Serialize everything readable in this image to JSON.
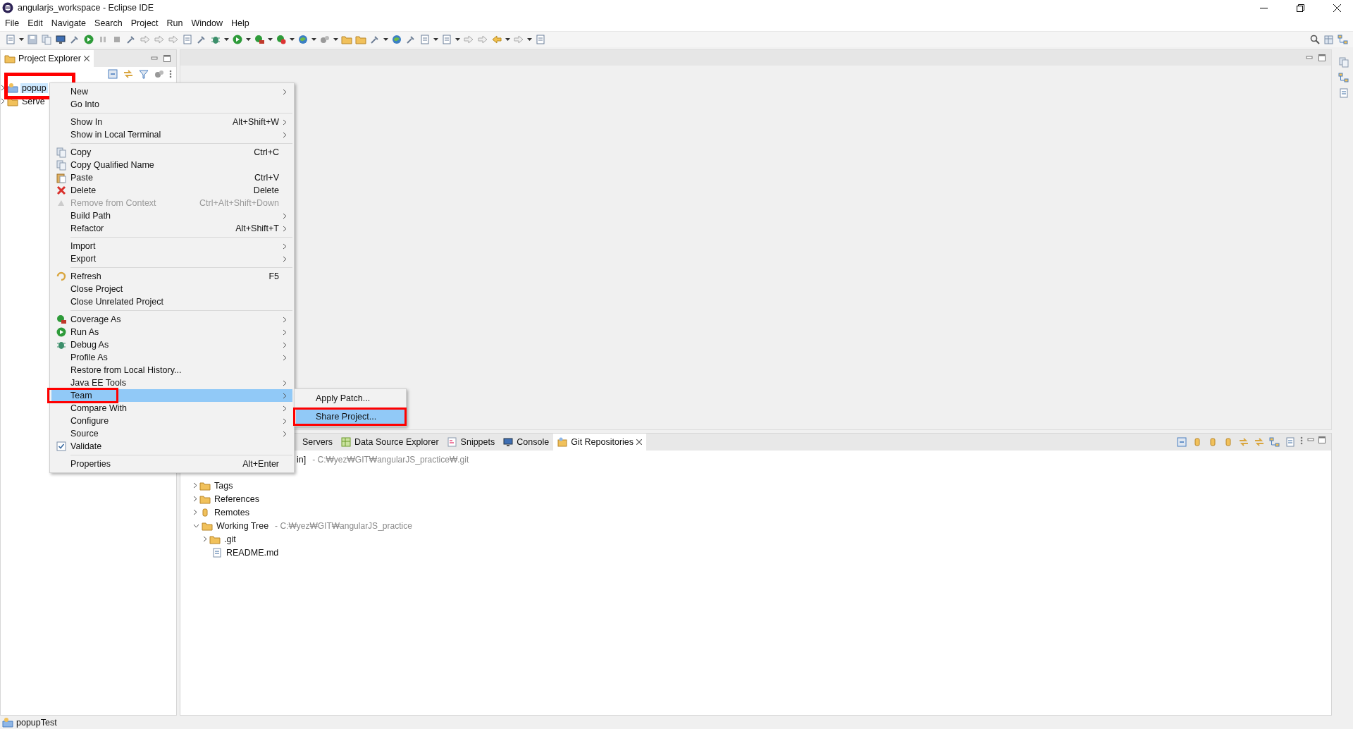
{
  "window": {
    "title": "angularjs_workspace - Eclipse IDE"
  },
  "menu_bar": [
    "File",
    "Edit",
    "Navigate",
    "Search",
    "Project",
    "Run",
    "Window",
    "Help"
  ],
  "project_explorer": {
    "title": "Project Explorer",
    "items": [
      {
        "label": "popup",
        "selected": true
      },
      {
        "label": "Serve",
        "selected": false
      }
    ]
  },
  "context_menu": {
    "items": [
      {
        "kind": "item",
        "label": "New",
        "submenu": true,
        "disabled": false,
        "selected": false
      },
      {
        "kind": "item",
        "label": "Go Into",
        "submenu": false,
        "disabled": false,
        "selected": false
      },
      {
        "kind": "separator"
      },
      {
        "kind": "item",
        "label": "Show In",
        "shortcut": "Alt+Shift+W",
        "submenu": true,
        "disabled": false,
        "selected": false
      },
      {
        "kind": "item",
        "label": "Show in Local Terminal",
        "submenu": true,
        "disabled": false,
        "selected": false
      },
      {
        "kind": "separator"
      },
      {
        "kind": "item",
        "label": "Copy",
        "shortcut": "Ctrl+C",
        "submenu": false,
        "disabled": false,
        "selected": false
      },
      {
        "kind": "item",
        "label": "Copy Qualified Name",
        "submenu": false,
        "disabled": false,
        "selected": false
      },
      {
        "kind": "item",
        "label": "Paste",
        "shortcut": "Ctrl+V",
        "submenu": false,
        "disabled": false,
        "selected": false
      },
      {
        "kind": "item",
        "label": "Delete",
        "shortcut": "Delete",
        "submenu": false,
        "disabled": false,
        "selected": false
      },
      {
        "kind": "item",
        "label": "Remove from Context",
        "shortcut": "Ctrl+Alt+Shift+Down",
        "submenu": false,
        "disabled": true,
        "selected": false
      },
      {
        "kind": "item",
        "label": "Build Path",
        "submenu": true,
        "disabled": false,
        "selected": false
      },
      {
        "kind": "item",
        "label": "Refactor",
        "shortcut": "Alt+Shift+T",
        "submenu": true,
        "disabled": false,
        "selected": false
      },
      {
        "kind": "separator"
      },
      {
        "kind": "item",
        "label": "Import",
        "submenu": true,
        "disabled": false,
        "selected": false
      },
      {
        "kind": "item",
        "label": "Export",
        "submenu": true,
        "disabled": false,
        "selected": false
      },
      {
        "kind": "separator"
      },
      {
        "kind": "item",
        "label": "Refresh",
        "shortcut": "F5",
        "submenu": false,
        "disabled": false,
        "selected": false
      },
      {
        "kind": "item",
        "label": "Close Project",
        "submenu": false,
        "disabled": false,
        "selected": false
      },
      {
        "kind": "item",
        "label": "Close Unrelated Project",
        "submenu": false,
        "disabled": false,
        "selected": false
      },
      {
        "kind": "separator"
      },
      {
        "kind": "item",
        "label": "Coverage As",
        "submenu": true,
        "disabled": false,
        "selected": false
      },
      {
        "kind": "item",
        "label": "Run As",
        "submenu": true,
        "disabled": false,
        "selected": false
      },
      {
        "kind": "item",
        "label": "Debug As",
        "submenu": true,
        "disabled": false,
        "selected": false
      },
      {
        "kind": "item",
        "label": "Profile As",
        "submenu": true,
        "disabled": false,
        "selected": false
      },
      {
        "kind": "item",
        "label": "Restore from Local History...",
        "submenu": false,
        "disabled": false,
        "selected": false
      },
      {
        "kind": "item",
        "label": "Java EE Tools",
        "submenu": true,
        "disabled": false,
        "selected": false
      },
      {
        "kind": "item",
        "label": "Team",
        "submenu": true,
        "disabled": false,
        "selected": true
      },
      {
        "kind": "item",
        "label": "Compare With",
        "submenu": true,
        "disabled": false,
        "selected": false
      },
      {
        "kind": "item",
        "label": "Configure",
        "submenu": true,
        "disabled": false,
        "selected": false
      },
      {
        "kind": "item",
        "label": "Source",
        "submenu": true,
        "disabled": false,
        "selected": false
      },
      {
        "kind": "check",
        "label": "Validate",
        "checked": true,
        "submenu": false,
        "disabled": false,
        "selected": false
      },
      {
        "kind": "separator"
      },
      {
        "kind": "item",
        "label": "Properties",
        "shortcut": "Alt+Enter",
        "submenu": false,
        "disabled": false,
        "selected": false
      }
    ]
  },
  "submenu": {
    "items": [
      {
        "label": "Apply Patch...",
        "selected": false
      },
      {
        "label": "Share Project...",
        "selected": true
      }
    ]
  },
  "bottom_panel": {
    "tabs": [
      {
        "label": "Servers",
        "selected": false
      },
      {
        "label": "Data Source Explorer",
        "selected": false
      },
      {
        "label": "Snippets",
        "selected": false
      },
      {
        "label": "Console",
        "selected": false
      },
      {
        "label": "Git Repositories",
        "selected": true
      }
    ]
  },
  "repository": {
    "label": "in]",
    "detail": "- C:₩yez₩GIT₩angularJS_practice₩.git",
    "children": [
      {
        "kind": "node",
        "label": "Tags",
        "expanded": false
      },
      {
        "kind": "node",
        "label": "References",
        "expanded": false
      },
      {
        "kind": "node",
        "label": "Remotes",
        "expanded": false
      },
      {
        "kind": "node",
        "label": "Working Tree",
        "detail": "- C:₩yez₩GIT₩angularJS_practice",
        "expanded": true,
        "children": [
          {
            "kind": "node",
            "label": ".git",
            "expanded": false
          },
          {
            "kind": "leaf",
            "label": "README.md"
          }
        ]
      }
    ]
  },
  "status_bar": {
    "text": "popupTest"
  }
}
